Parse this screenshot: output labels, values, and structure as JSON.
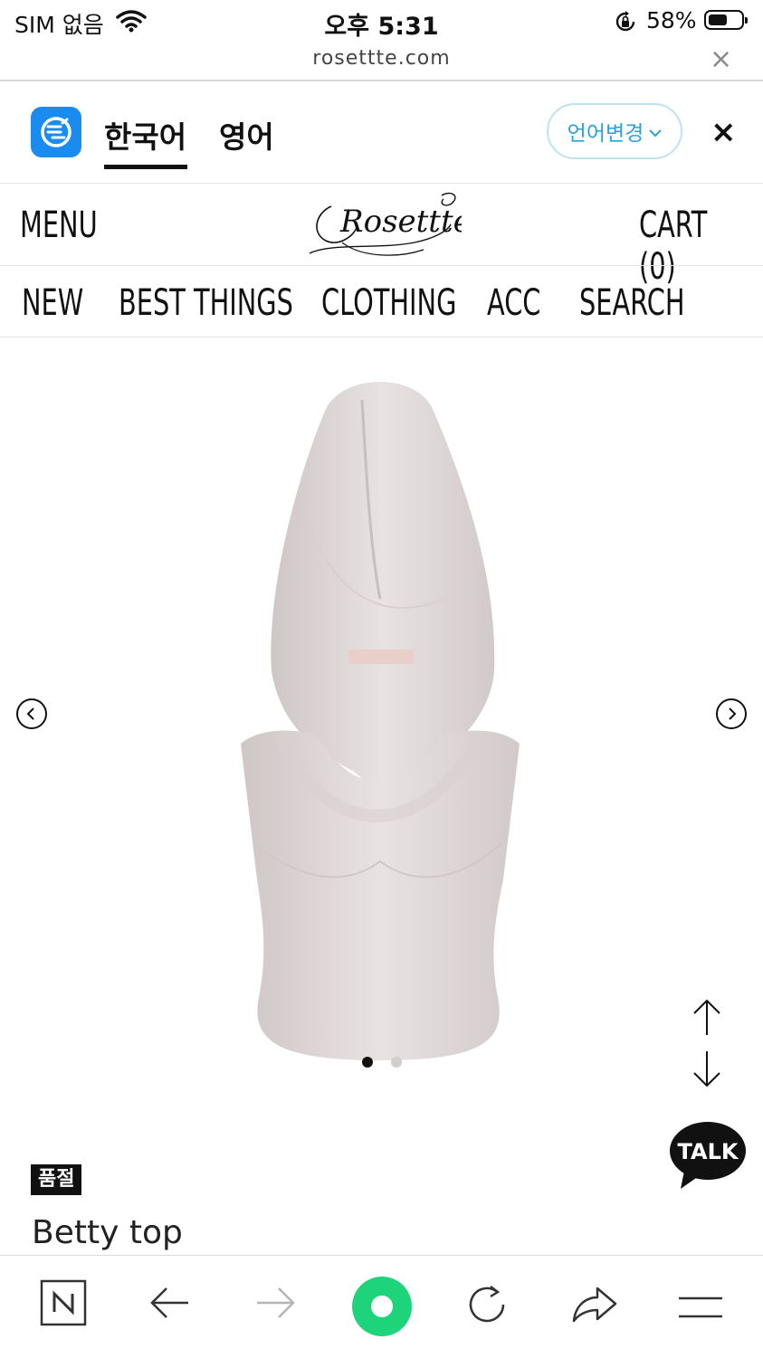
{
  "status_bar": {
    "carrier": "SIM 없음",
    "time": "오후 5:31",
    "battery_percent": "58%"
  },
  "browser": {
    "url": "rosettte.com",
    "close_glyph": "×"
  },
  "translate_bar": {
    "tab_korean": "한국어",
    "tab_english": "영어",
    "change_language_label": "언어변경",
    "close_glyph": "×"
  },
  "header": {
    "menu_label": "MENU",
    "logo_text": "Rosettte",
    "cart_label": "CART (0)"
  },
  "nav": {
    "items": [
      {
        "label": "NEW"
      },
      {
        "label": "BEST THINGS"
      },
      {
        "label": "CLOTHING"
      },
      {
        "label": "ACC"
      },
      {
        "label": "SEARCH"
      }
    ]
  },
  "gallery": {
    "active_slide": 1,
    "slide_count": 2
  },
  "product": {
    "badge": "품절",
    "name": "Betty top"
  },
  "chat": {
    "label": "TALK"
  },
  "colors": {
    "accent_blue": "#1a8cf0",
    "lang_button_text": "#2aa1dc",
    "green_button": "#1ed47a"
  }
}
